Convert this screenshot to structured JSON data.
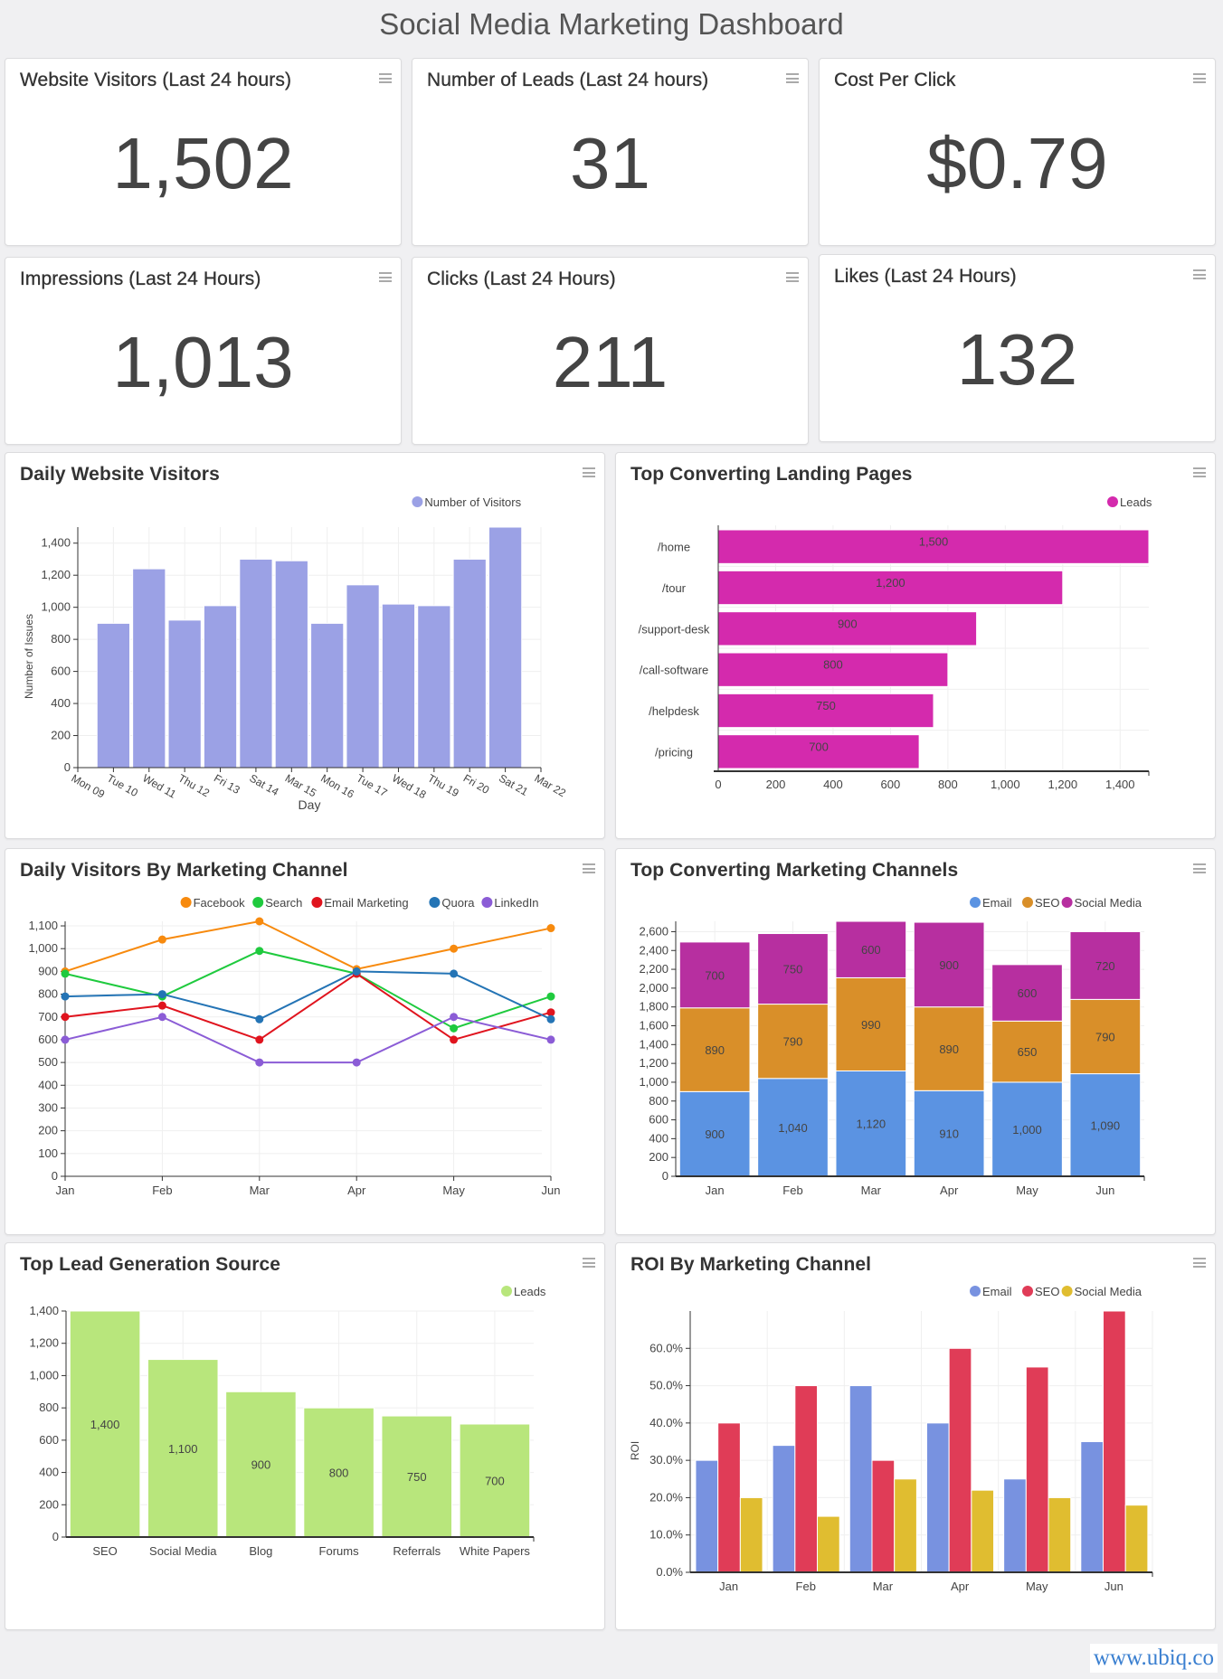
{
  "page_title": "Social Media Marketing Dashboard",
  "kpis": [
    {
      "title": "Website Visitors (Last 24 hours)",
      "value": "1,502"
    },
    {
      "title": "Number of Leads (Last 24 hours)",
      "value": "31"
    },
    {
      "title": "Cost Per Click",
      "value": "$0.79"
    },
    {
      "title": "Impressions (Last 24 Hours)",
      "value": "1,013"
    },
    {
      "title": "Clicks (Last 24 Hours)",
      "value": "211"
    },
    {
      "title": "Likes (Last 24 Hours)",
      "value": "132"
    }
  ],
  "menu_icon": "hamburger-menu-icon",
  "footer": {
    "link_text": "www.ubiq.co"
  },
  "colors": {
    "visitors": "#9ba1e5",
    "landing": "#d42aad",
    "facebook": "#f78a0e",
    "search": "#1fca3e",
    "email_marketing": "#e0141e",
    "quora": "#2474b5",
    "linkedin": "#8b5cd6",
    "conv_email": "#5b93e2",
    "conv_seo": "#d98f29",
    "conv_social": "#b72fa0",
    "leads_green": "#b8e67c",
    "roi_email": "#7892e0",
    "roi_seo": "#e03c57",
    "roi_social": "#e0bd30"
  },
  "chart_data": [
    {
      "id": "daily-visitors",
      "type": "bar",
      "title": "Daily Website Visitors",
      "legend": [
        "Number of Visitors"
      ],
      "legend_position": "top-right",
      "xlabel": "Day",
      "ylabel": "Number of Issues",
      "x_tick_labels": [
        "Mon 09",
        "Tue 10",
        "Wed 11",
        "Thu 12",
        "Fri 13",
        "Sat 14",
        "Mar 15",
        "Mon 16",
        "Tue 17",
        "Wed 18",
        "Thu 19",
        "Fri 20",
        "Sat 21",
        "Mar 22"
      ],
      "values": [
        900,
        1240,
        920,
        1010,
        1300,
        1290,
        900,
        1140,
        1020,
        1010,
        1300,
        1500
      ],
      "y_ticks": [
        0,
        200,
        400,
        600,
        800,
        1000,
        1200,
        1400
      ],
      "y_tick_labels": [
        "0",
        "200",
        "400",
        "600",
        "800",
        "1,000",
        "1,200",
        "1,400"
      ],
      "ylim": [
        0,
        1500
      ],
      "grid": true
    },
    {
      "id": "landing-pages",
      "type": "bar",
      "orientation": "horizontal",
      "title": "Top Converting Landing Pages",
      "legend": [
        "Leads"
      ],
      "legend_position": "top-right",
      "categories": [
        "/home",
        "/tour",
        "/support-desk",
        "/call-software",
        "/helpdesk",
        "/pricing"
      ],
      "values": [
        1500,
        1200,
        900,
        800,
        750,
        700
      ],
      "data_labels": [
        "1,500",
        "1,200",
        "900",
        "800",
        "750",
        "700"
      ],
      "x_ticks": [
        0,
        200,
        400,
        600,
        800,
        1000,
        1200,
        1400
      ],
      "x_tick_labels": [
        "0",
        "200",
        "400",
        "600",
        "800",
        "1,000",
        "1,200",
        "1,400"
      ],
      "xlim": [
        0,
        1500
      ],
      "grid": true
    },
    {
      "id": "visitors-by-channel",
      "type": "line",
      "title": "Daily Visitors By Marketing Channel",
      "legend_position": "top-right",
      "categories": [
        "Jan",
        "Feb",
        "Mar",
        "Apr",
        "May",
        "Jun"
      ],
      "series": [
        {
          "name": "Facebook",
          "values": [
            900,
            1040,
            1120,
            910,
            1000,
            1090
          ]
        },
        {
          "name": "Search",
          "values": [
            890,
            790,
            990,
            890,
            650,
            790
          ]
        },
        {
          "name": "Email Marketing",
          "values": [
            700,
            750,
            600,
            890,
            600,
            720
          ]
        },
        {
          "name": "Quora",
          "values": [
            790,
            800,
            690,
            900,
            890,
            690
          ]
        },
        {
          "name": "LinkedIn",
          "values": [
            600,
            700,
            500,
            500,
            700,
            600
          ]
        }
      ],
      "y_ticks": [
        0,
        100,
        200,
        300,
        400,
        500,
        600,
        700,
        800,
        900,
        1000,
        1100
      ],
      "y_tick_labels": [
        "0",
        "100",
        "200",
        "300",
        "400",
        "500",
        "600",
        "700",
        "800",
        "900",
        "1,000",
        "1,100"
      ],
      "ylim": [
        0,
        1120
      ],
      "grid": true
    },
    {
      "id": "converting-channels",
      "type": "bar",
      "stacked": true,
      "title": "Top Converting Marketing Channels",
      "legend_position": "top-right",
      "categories": [
        "Jan",
        "Feb",
        "Mar",
        "Apr",
        "May",
        "Jun"
      ],
      "series": [
        {
          "name": "Email",
          "values": [
            900,
            1040,
            1120,
            910,
            1000,
            1090
          ],
          "labels": [
            "900",
            "1,040",
            "1,120",
            "910",
            "1,000",
            "1,090"
          ]
        },
        {
          "name": "SEO",
          "values": [
            890,
            790,
            990,
            890,
            650,
            790
          ],
          "labels": [
            "890",
            "790",
            "990",
            "890",
            "650",
            "790"
          ]
        },
        {
          "name": "Social Media",
          "values": [
            700,
            750,
            600,
            900,
            600,
            720
          ],
          "labels": [
            "700",
            "750",
            "600",
            "900",
            "600",
            "720"
          ]
        }
      ],
      "y_ticks": [
        0,
        200,
        400,
        600,
        800,
        1000,
        1200,
        1400,
        1600,
        1800,
        2000,
        2200,
        2400,
        2600
      ],
      "y_tick_labels": [
        "0",
        "200",
        "400",
        "600",
        "800",
        "1,000",
        "1,200",
        "1,400",
        "1,600",
        "1,800",
        "2,000",
        "2,200",
        "2,400",
        "2,600"
      ],
      "ylim": [
        0,
        2710
      ],
      "grid": true
    },
    {
      "id": "lead-sources",
      "type": "bar",
      "title": "Top Lead Generation Source",
      "legend": [
        "Leads"
      ],
      "legend_position": "top-right",
      "categories": [
        "SEO",
        "Social Media",
        "Blog",
        "Forums",
        "Referrals",
        "White Papers"
      ],
      "values": [
        1400,
        1100,
        900,
        800,
        750,
        700
      ],
      "data_labels": [
        "1,400",
        "1,100",
        "900",
        "800",
        "750",
        "700"
      ],
      "y_ticks": [
        0,
        200,
        400,
        600,
        800,
        1000,
        1200,
        1400
      ],
      "y_tick_labels": [
        "0",
        "200",
        "400",
        "600",
        "800",
        "1,000",
        "1,200",
        "1,400"
      ],
      "ylim": [
        0,
        1400
      ],
      "grid": true
    },
    {
      "id": "roi-by-channel",
      "type": "bar",
      "title": "ROI By Marketing Channel",
      "ylabel": "ROI",
      "legend_position": "top-right",
      "categories": [
        "Jan",
        "Feb",
        "Mar",
        "Apr",
        "May",
        "Jun"
      ],
      "series": [
        {
          "name": "Email",
          "values": [
            30,
            34,
            50,
            40,
            25,
            35
          ]
        },
        {
          "name": "SEO",
          "values": [
            40,
            50,
            30,
            60,
            55,
            70
          ]
        },
        {
          "name": "Social Media",
          "values": [
            20,
            15,
            25,
            22,
            20,
            18
          ]
        }
      ],
      "y_ticks": [
        0,
        10,
        20,
        30,
        40,
        50,
        60
      ],
      "y_tick_labels": [
        "0.0%",
        "10.0%",
        "20.0%",
        "30.0%",
        "40.0%",
        "50.0%",
        "60.0%"
      ],
      "ylim": [
        0,
        70
      ],
      "grid": true
    }
  ]
}
